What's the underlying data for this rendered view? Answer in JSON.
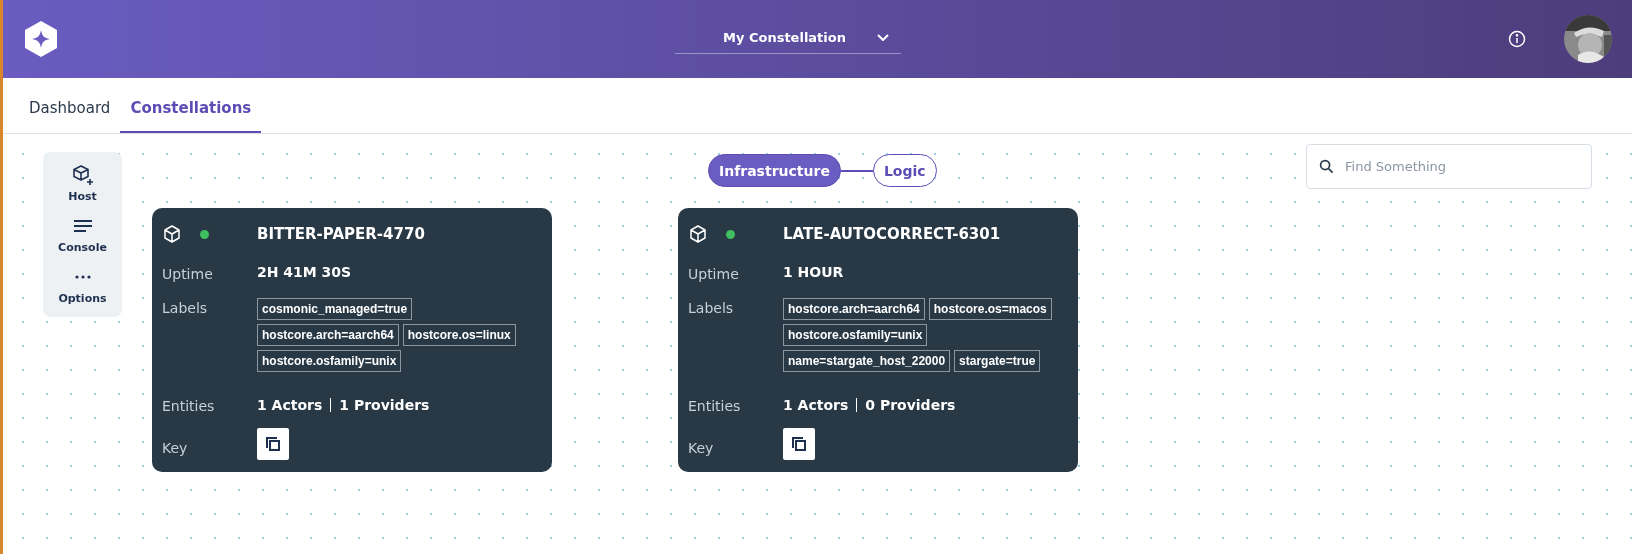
{
  "header": {
    "constellation_select": "My Constellation"
  },
  "tabs": [
    {
      "label": "Dashboard",
      "selected": false
    },
    {
      "label": "Constellations",
      "selected": true
    }
  ],
  "toolbar": [
    {
      "kind": "host",
      "label": "Host"
    },
    {
      "kind": "console",
      "label": "Console"
    },
    {
      "kind": "options",
      "label": "Options"
    }
  ],
  "view_toggle": [
    {
      "label": "Infrastructure",
      "selected": true
    },
    {
      "label": "Logic",
      "selected": false
    }
  ],
  "search": {
    "placeholder": "Find Something"
  },
  "hosts": [
    {
      "name": "BITTER-PAPER-4770",
      "color": "#3fbf5f",
      "uptime_label": "Uptime",
      "uptime": "2H 41M 30S",
      "labels_label": "Labels",
      "labels": [
        "cosmonic_managed=true",
        "hostcore.arch=aarch64",
        "hostcore.os=linux",
        "hostcore.osfamily=unix"
      ],
      "entities_label": "Entities",
      "actors": "1 Actors",
      "providers": "1 Providers",
      "key_label": "Key"
    },
    {
      "name": "LATE-AUTOCORRECT-6301",
      "color": "#3fbf5f",
      "uptime_label": "Uptime",
      "uptime": "1 HOUR",
      "labels_label": "Labels",
      "labels": [
        "hostcore.arch=aarch64",
        "hostcore.os=macos",
        "hostcore.osfamily=unix",
        "name=stargate_host_22000",
        "stargate=true"
      ],
      "entities_label": "Entities",
      "actors": "1 Actors",
      "providers": "0 Providers",
      "key_label": "Key"
    }
  ]
}
